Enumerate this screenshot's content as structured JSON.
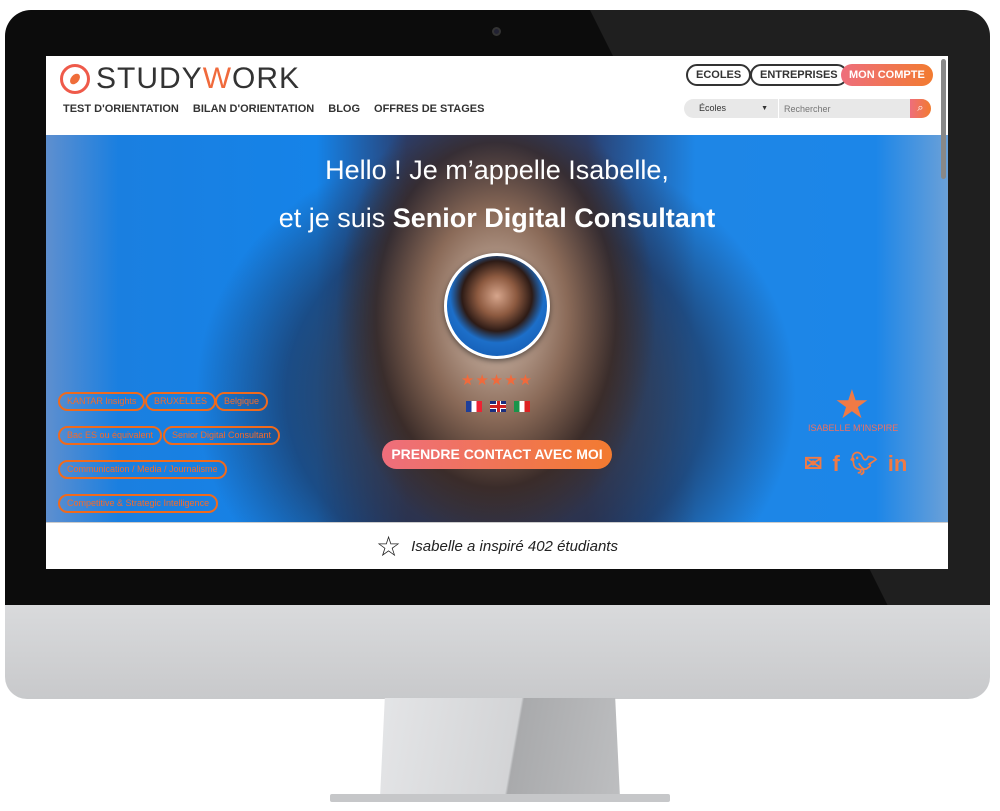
{
  "device": {
    "apple_logo": ""
  },
  "header": {
    "logo": {
      "part1": "STUDY",
      "part2": "W",
      "part3": "ORK"
    },
    "nav": [
      "TEST D'ORIENTATION",
      "BILAN D'ORIENTATION",
      "BLOG",
      "OFFRES DE STAGES"
    ],
    "buttons": {
      "ecoles": "ECOLES",
      "entreprises": "ENTREPRISES",
      "compte": "MON COMPTE"
    },
    "search": {
      "category": "Écoles",
      "placeholder": "Rechercher"
    }
  },
  "hero": {
    "line1": "Hello ! Je m’appelle Isabelle,",
    "line2_prefix": "et je suis ",
    "line2_bold": "Senior Digital Consultant",
    "rating_stars": "★★★★★",
    "rating": 5,
    "languages": [
      "fr",
      "gb",
      "it"
    ],
    "cta": "PRENDRE CONTACT AVEC MOI",
    "tags": [
      "KANTAR Insights",
      "BRUXELLES",
      "Belgique",
      "Bac ES ou équivalent",
      "Senior Digital Consultant",
      "Communication / Media / Journalisme",
      "Competitive & Strategic Intelligence"
    ],
    "inspire_label": "ISABELLE M'INSPIRE",
    "social": [
      "email-icon",
      "facebook-icon",
      "twitter-icon",
      "linkedin-icon"
    ]
  },
  "footer_bar": {
    "text": "Isabelle a inspiré 402 étudiants"
  },
  "colors": {
    "accent": "#f06a3c",
    "accent_gradient_start": "#ee6e7c",
    "accent_gradient_end": "#f27b30"
  }
}
